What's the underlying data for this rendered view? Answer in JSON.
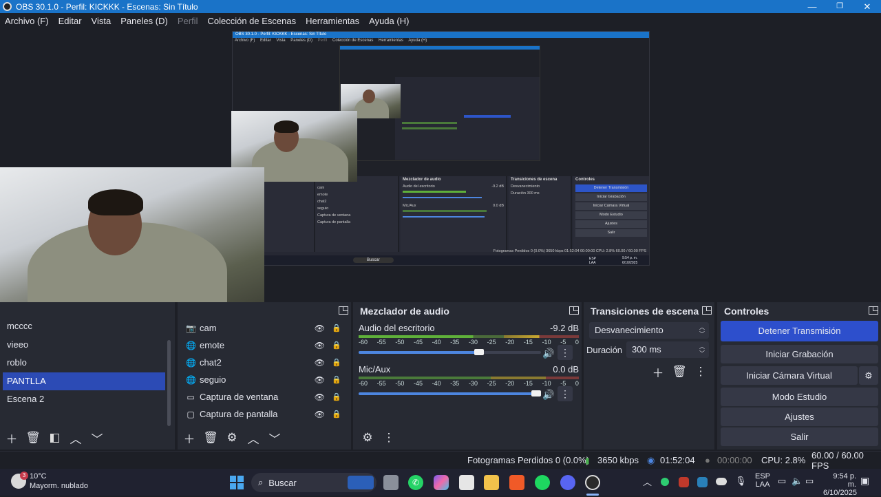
{
  "window": {
    "title": "OBS 30.1.0 - Perfil: KICKKK - Escenas: Sin Título",
    "minimize": "—",
    "maximize": "❐",
    "close": "✕"
  },
  "menu": {
    "items": [
      "Archivo (F)",
      "Editar",
      "Vista",
      "Paneles (D)",
      "Perfil",
      "Colección de Escenas",
      "Herramientas",
      "Ayuda (H)"
    ]
  },
  "nested_preview": {
    "title": "OBS 30.1.0 - Perfil: KICKKK - Escenas: Sin Título",
    "menu": [
      "Archivo (F)",
      "Editar",
      "Vista",
      "Paneles (D)",
      "Perfil",
      "Colección de Escenas",
      "Herramientas",
      "Ayuda (H)"
    ],
    "mixer_title": "Mezclador de audio",
    "transitions_title": "Transiciones de escena",
    "controls_title": "Controles",
    "sources": [
      "cam",
      "emote",
      "chat2",
      "seguio",
      "Captura de ventana",
      "Captura de pantalla"
    ],
    "audio1": "Audio del escritorio",
    "audio1_db": "-9.2 dB",
    "audio2": "Mic/Aux",
    "audio2_db": "0.0 dB",
    "transition": "Desvanecimiento",
    "duration_label": "Duración",
    "duration": "300 ms",
    "controls": [
      "Detener Transmisión",
      "Iniciar Grabación",
      "Iniciar Cámara Virtual",
      "Modo Estudio",
      "Ajustes",
      "Salir"
    ],
    "status": "Fotogramas Perdidos 0 (0.0%)   3650 kbps   01:52:04   00:00:00   CPU: 2.8%   60.00 / 60.00 FPS",
    "search": "Buscar",
    "lang": "ESP LAA",
    "time": "9:54 p. m.",
    "date": "6/10/2025"
  },
  "scenes": {
    "items": [
      "mcccc",
      "vieeo",
      "roblo",
      "PANTLLA",
      "Escena 2"
    ],
    "selected_index": 3
  },
  "sources": {
    "items": [
      {
        "name": "cam",
        "icon": "camera-icon"
      },
      {
        "name": "emote",
        "icon": "globe-icon"
      },
      {
        "name": "chat2",
        "icon": "globe-icon"
      },
      {
        "name": "seguio",
        "icon": "globe-icon"
      },
      {
        "name": "Captura de ventana",
        "icon": "window-icon"
      },
      {
        "name": "Captura de pantalla",
        "icon": "monitor-icon"
      }
    ]
  },
  "mixer": {
    "title": "Mezclador de audio",
    "ticks": [
      "-60",
      "-55",
      "-50",
      "-45",
      "-40",
      "-35",
      "-30",
      "-25",
      "-20",
      "-15",
      "-10",
      "-5",
      "0"
    ],
    "channels": [
      {
        "name": "Audio del escritorio",
        "db": "-9.2 dB",
        "volume": 0.66
      },
      {
        "name": "Mic/Aux",
        "db": "0.0 dB",
        "volume": 1.0
      }
    ]
  },
  "transitions": {
    "title": "Transiciones de escena",
    "selected": "Desvanecimiento",
    "duration_label": "Duración",
    "duration_value": "300 ms"
  },
  "controls": {
    "title": "Controles",
    "stop_stream": "Detener Transmisión",
    "start_record": "Iniciar Grabación",
    "virtual_cam": "Iniciar Cámara Virtual",
    "studio_mode": "Modo Estudio",
    "settings": "Ajustes",
    "exit": "Salir"
  },
  "status": {
    "dropped_frames": "Fotogramas Perdidos 0 (0.0%)",
    "bitrate": "3650 kbps",
    "stream_time": "01:52:04",
    "record_time": "00:00:00",
    "cpu": "CPU: 2.8%",
    "fps": "60.00 / 60.00 FPS"
  },
  "taskbar": {
    "weather_temp": "10°C",
    "weather_desc": "Mayorm. nublado",
    "weather_badge": "3",
    "search_placeholder": "Buscar",
    "lang_line1": "ESP",
    "lang_line2": "LAA",
    "time": "9:54 p. m.",
    "date": "6/10/2025"
  },
  "colors": {
    "accent": "#2d4fcc",
    "titlebar": "#1a73c8",
    "dock_bg": "#272a33",
    "app_bg": "#1d1f26"
  }
}
